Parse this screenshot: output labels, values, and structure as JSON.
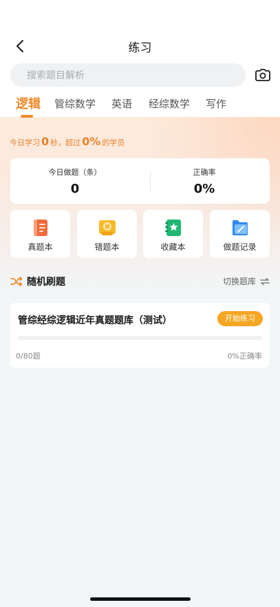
{
  "header": {
    "title": "练习"
  },
  "search": {
    "placeholder": "搜索题目解析"
  },
  "tabs": [
    {
      "label": "逻辑",
      "active": true
    },
    {
      "label": "管综数学",
      "active": false
    },
    {
      "label": "英语",
      "active": false
    },
    {
      "label": "经综数学",
      "active": false
    },
    {
      "label": "写作",
      "active": false
    }
  ],
  "study": {
    "prefix": "今日学习",
    "seconds": "0",
    "seconds_unit": "秒，超过",
    "percent": "0%",
    "suffix": "的学员"
  },
  "stats": {
    "done_label": "今日做题（条）",
    "done_value": "0",
    "rate_label": "正确率",
    "rate_value": "0%"
  },
  "tiles": [
    {
      "label": "真题本",
      "icon": "notebook-icon"
    },
    {
      "label": "错题本",
      "icon": "wrong-questions-icon"
    },
    {
      "label": "收藏本",
      "icon": "favorites-star-icon"
    },
    {
      "label": "做题记录",
      "icon": "record-folder-icon"
    }
  ],
  "random": {
    "title": "随机刷题",
    "switch_label": "切换题库"
  },
  "bank": {
    "title": "管综经综逻辑近年真题题库（测试）",
    "start_label": "开始练习",
    "count": "0/80题",
    "rate": "0%正确率",
    "progress": 0
  },
  "colors": {
    "accent": "#ef8a2a",
    "button": "#f5a623"
  }
}
